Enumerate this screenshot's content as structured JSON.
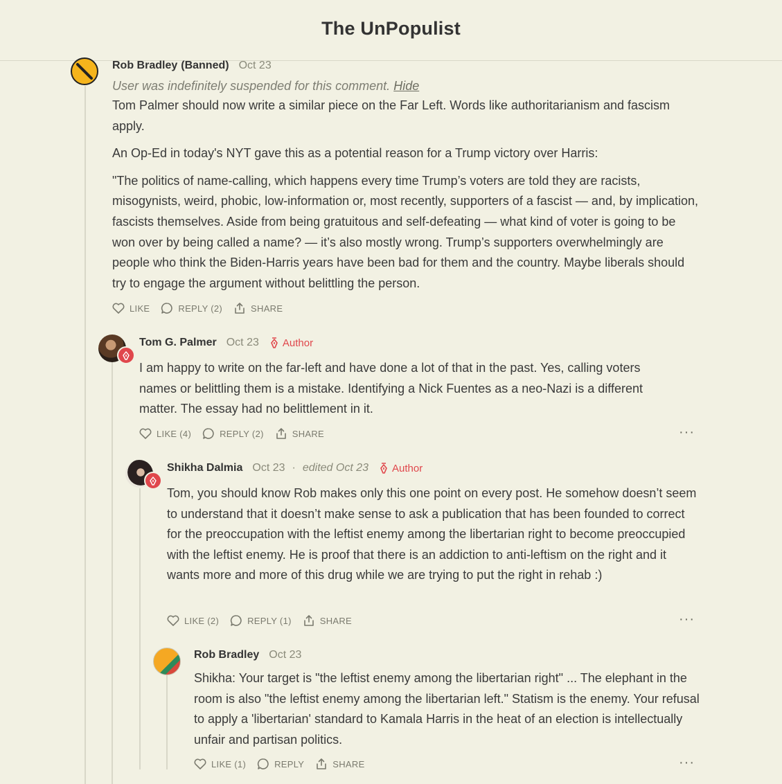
{
  "site": {
    "title": "The UnPopulist"
  },
  "labels": {
    "like": "LIKE",
    "reply": "REPLY",
    "share": "SHARE",
    "author": "Author",
    "more": "···"
  },
  "colors": {
    "background": "#f2f1e3",
    "author_accent": "#e0474c"
  },
  "comments": [
    {
      "author": "Rob Bradley",
      "banned_label": "(Banned)",
      "date": "Oct 23",
      "suspended_note": "User was indefinitely suspended for this comment.",
      "hide_label": "Hide",
      "paragraphs": [
        "Tom Palmer should now write a similar piece on the Far Left. Words like authoritarianism and fascism apply.",
        "An Op-Ed in today's NYT gave this as a potential reason for a Trump victory over Harris:",
        "\"The politics of name-calling, which happens every time Trump’s voters are told they are racists, misogynists, weird, phobic, low-information or, most recently, supporters of a fascist — and, by implication, fascists themselves. Aside from being gratuitous and self-defeating — what kind of voter is going to be won over by being called a name? — it’s also mostly wrong. Trump’s supporters overwhelmingly are people who think the Biden-Harris years have been bad for them and the country. Maybe liberals should try to engage the argument without belittling the person."
      ],
      "like": "LIKE",
      "reply": "REPLY (2)",
      "share": "SHARE",
      "avatar_icon": "banned-icon"
    },
    {
      "author": "Tom G. Palmer",
      "date": "Oct 23",
      "badge": "Author",
      "paragraphs": [
        "I am happy to write on the far-left and have done a lot of that in the past. Yes, calling voters names or belittling them is a mistake. Identifying a Nick Fuentes as a neo-Nazi is a different matter. The essay had no belittlement in it."
      ],
      "like": "LIKE (4)",
      "reply": "REPLY (2)",
      "share": "SHARE"
    },
    {
      "author": "Shikha Dalmia",
      "date": "Oct 23",
      "edited": "edited Oct 23",
      "badge": "Author",
      "paragraphs": [
        "Tom, you should know Rob makes only this one point on every post. He somehow doesn’t seem to understand that it doesn’t make sense to ask a publication that has been founded to correct for the preoccupation with the leftist enemy among the libertarian right to become preoccupied with the leftist enemy. He is proof that there is an addiction to anti-leftism on the right and it wants more and more of this drug while we are trying to put the right in rehab :)"
      ],
      "like": "LIKE (2)",
      "reply": "REPLY (1)",
      "share": "SHARE"
    },
    {
      "author": "Rob Bradley",
      "date": "Oct 23",
      "paragraphs": [
        "Shikha: Your target is \"the leftist enemy among the libertarian right\" ... The elephant in the room is also \"the leftist enemy among the libertarian left.\" Statism is the enemy. Your refusal to apply a 'libertarian' standard to Kamala Harris in the heat of an election is intellectually unfair and partisan politics."
      ],
      "like": "LIKE (1)",
      "reply": "REPLY",
      "share": "SHARE"
    }
  ]
}
